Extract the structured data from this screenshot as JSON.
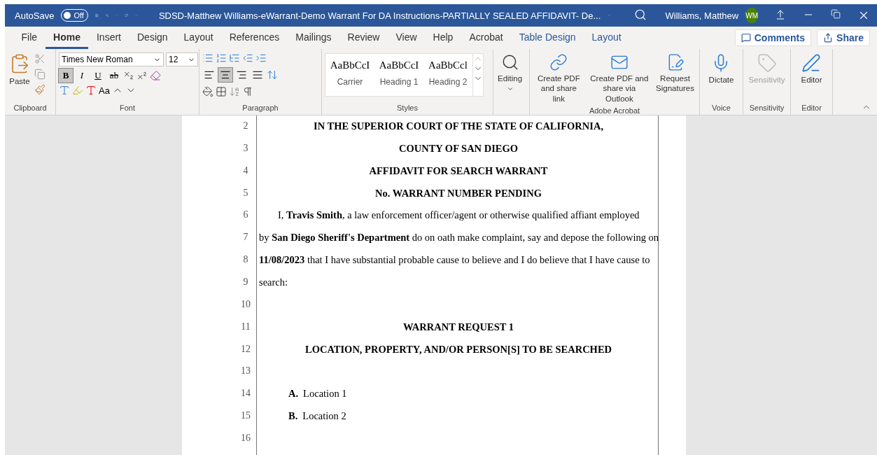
{
  "title_bar": {
    "autosave_label": "AutoSave",
    "autosave": {
      "label": "Off",
      "on": false
    },
    "title": "SDSD-Matthew Williams-eWarrant-Demo Warrant For DA Instructions-PARTIALLY SEALED AFFIDAVIT- De...",
    "user": "Williams, Matthew",
    "avatar": "WM"
  },
  "tabs": [
    {
      "label": "File",
      "selected": false,
      "kind": "normal"
    },
    {
      "label": "Home",
      "selected": true,
      "kind": "normal"
    },
    {
      "label": "Insert",
      "selected": false,
      "kind": "normal"
    },
    {
      "label": "Design",
      "selected": false,
      "kind": "normal"
    },
    {
      "label": "Layout",
      "selected": false,
      "kind": "normal"
    },
    {
      "label": "References",
      "selected": false,
      "kind": "normal"
    },
    {
      "label": "Mailings",
      "selected": false,
      "kind": "normal"
    },
    {
      "label": "Review",
      "selected": false,
      "kind": "normal"
    },
    {
      "label": "View",
      "selected": false,
      "kind": "normal"
    },
    {
      "label": "Help",
      "selected": false,
      "kind": "normal"
    },
    {
      "label": "Acrobat",
      "selected": false,
      "kind": "normal"
    },
    {
      "label": "Table Design",
      "selected": false,
      "kind": "contextual"
    },
    {
      "label": "Layout",
      "selected": false,
      "kind": "contextual"
    }
  ],
  "comments_button": "Comments",
  "share_button": "Share",
  "ribbon": {
    "clipboard": {
      "paste": "Paste",
      "label": "Clipboard"
    },
    "font": {
      "name": "Times New Roman",
      "size": "12",
      "label": "Font",
      "change_case": "Aa",
      "styles": [
        {
          "label": "B",
          "kind": "bold",
          "selected": true
        },
        {
          "label": "I",
          "kind": "italic",
          "selected": false
        },
        {
          "label": "U",
          "kind": "underline",
          "selected": false
        },
        {
          "label": "ab",
          "kind": "strike",
          "selected": false
        }
      ]
    },
    "paragraph": {
      "label": "Paragraph",
      "align": [
        {
          "kind": "left",
          "selected": false
        },
        {
          "kind": "center",
          "selected": true
        },
        {
          "kind": "right",
          "selected": false
        },
        {
          "kind": "justify",
          "selected": false
        }
      ]
    },
    "styles": {
      "label": "Styles",
      "items": [
        {
          "preview": "AaBbCcI",
          "name": "Carrier"
        },
        {
          "preview": "AaBbCcI",
          "name": "Heading 1"
        },
        {
          "preview": "AaBbCcl",
          "name": "Heading 2"
        }
      ]
    },
    "editing": "Editing",
    "acrobat": {
      "label": "Adobe Acrobat",
      "buttons": [
        {
          "kind": "link",
          "label": "Create PDF and share link"
        },
        {
          "kind": "mail",
          "label": "Create PDF and share via Outlook"
        },
        {
          "kind": "sign",
          "label": "Request Signatures"
        }
      ]
    },
    "voice": {
      "label": "Voice",
      "button": "Dictate"
    },
    "sensitivity": {
      "label": "Sensitivity",
      "button": "Sensitivity",
      "disabled": true
    },
    "editor": {
      "label": "Editor",
      "button": "Editor"
    }
  },
  "document": {
    "lines": [
      {
        "number": "2",
        "kind": "center",
        "text": "**IN THE SUPERIOR COURT OF THE STATE OF CALIFORNIA,**"
      },
      {
        "number": "3",
        "kind": "center",
        "text": "**COUNTY OF SAN DIEGO**"
      },
      {
        "number": "4",
        "kind": "center",
        "text": "**AFFIDAVIT FOR SEARCH WARRANT**"
      },
      {
        "number": "5",
        "kind": "center",
        "text": "**No. WARRANT NUMBER PENDING**"
      },
      {
        "number": "6",
        "kind": "indent",
        "text": "I, **Travis Smith**, a law enforcement officer/agent or otherwise qualified affiant employed"
      },
      {
        "number": "7",
        "kind": "left",
        "text": "by **San Diego Sheriff's Department** do on oath make complaint, say and depose the following on"
      },
      {
        "number": "8",
        "kind": "left",
        "text": "**11/08/2023** that I have substantial probable cause to believe and I do believe that I have cause to"
      },
      {
        "number": "9",
        "kind": "left",
        "text": "search:"
      },
      {
        "number": "10"
      },
      {
        "number": "11",
        "kind": "center",
        "text": "**WARRANT REQUEST 1**"
      },
      {
        "number": "12",
        "kind": "center",
        "text": "**LOCATION, PROPERTY, AND/OR PERSON[S] TO BE SEARCHED**"
      },
      {
        "number": "13"
      },
      {
        "number": "14",
        "kind": "list",
        "marker": "A.",
        "text": "Location 1"
      },
      {
        "number": "15",
        "kind": "list",
        "marker": "B.",
        "text": "Location 2"
      },
      {
        "number": "16"
      }
    ]
  }
}
